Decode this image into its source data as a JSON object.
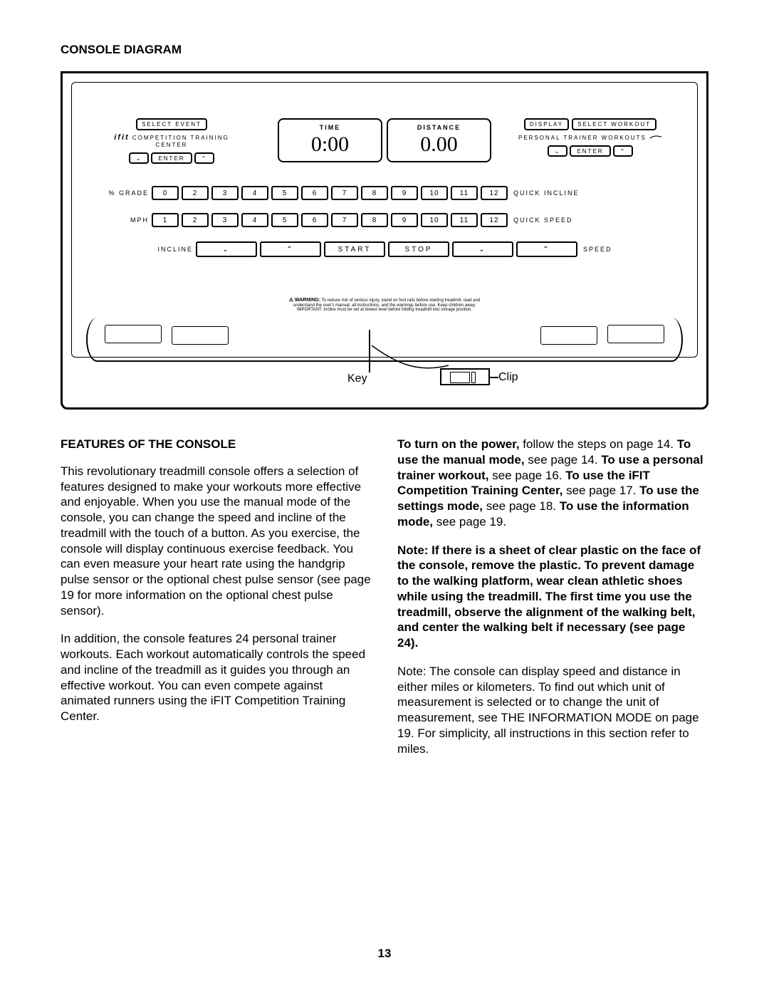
{
  "page_number": "13",
  "titles": {
    "diagram": "CONSOLE DIAGRAM",
    "features": "FEATURES OF THE CONSOLE"
  },
  "console": {
    "left_cluster": {
      "select_event": "SELECT EVENT",
      "ifit_prefix": "ifit",
      "ifit_text": " COMPETITION TRAINING CENTER",
      "enter": "ENTER"
    },
    "right_cluster": {
      "display": "DISPLAY",
      "select_workout": "SELECT WORKOUT",
      "ptw": "PERSONAL TRAINER WORKOUTS",
      "enter": "ENTER"
    },
    "displays": {
      "time_label": "TIME",
      "time_value": "0:00",
      "distance_label": "DISTANCE",
      "distance_value": "0.00"
    },
    "rows": {
      "grade_label": "% GRADE",
      "grade_vals": [
        "0",
        "2",
        "3",
        "4",
        "5",
        "6",
        "7",
        "8",
        "9",
        "10",
        "11",
        "12"
      ],
      "grade_suffix": "QUICK INCLINE",
      "mph_label": "MPH",
      "mph_vals": [
        "1",
        "2",
        "3",
        "4",
        "5",
        "6",
        "7",
        "8",
        "9",
        "10",
        "11",
        "12"
      ],
      "mph_suffix": "QUICK SPEED",
      "ctrl_incline": "INCLINE",
      "ctrl_start": "START",
      "ctrl_stop": "STOP",
      "ctrl_speed": "SPEED"
    },
    "warning": {
      "label": "⚠ WARNING:",
      "text": "To reduce risk of serious injury, stand on foot rails before starting treadmill, read and understand the user's manual, all instructions, and the warnings before use. Keep children away. IMPORTANT: Incline must be set at lowest level before folding treadmill into storage position."
    },
    "key_label": "Key",
    "clip_label": "Clip"
  },
  "body": {
    "p1": "This revolutionary treadmill console offers a selection of features designed to make your workouts more effective and enjoyable. When you use the manual mode of the console, you can change the speed and incline of the treadmill with the touch of a button. As you exercise, the console will display continuous exercise feedback. You can even measure your heart rate using the handgrip pulse sensor or the optional chest pulse sensor (see page 19 for more information on the optional chest pulse sensor).",
    "p2": "In addition, the console features 24 personal trainer workouts. Each workout automatically controls the speed and incline of the treadmill as it guides you through an effective workout. You can even compete against animated runners using the iFIT Competition Training Center.",
    "r1_a": "To turn on the power,",
    "r1_b": " follow the steps on page 14. ",
    "r1_c": "To use the manual mode,",
    "r1_d": " see page 14. ",
    "r1_e": "To use a personal trainer workout,",
    "r1_f": " see page 16. ",
    "r1_g": "To use the iFIT Competition Training Center,",
    "r1_h": " see page 17. ",
    "r1_i": "To use the settings mode,",
    "r1_j": " see page 18. ",
    "r1_k": "To use the information mode,",
    "r1_l": " see page 19.",
    "r2": "Note: If there is a sheet of clear plastic on the face of the console, remove the plastic. To prevent damage to the walking platform, wear clean athletic shoes while using the treadmill. The first time you use the treadmill, observe the alignment of the walking belt, and center the walking belt if necessary (see page 24).",
    "r3": "Note: The console can display speed and distance in either miles or kilometers. To find out which unit of measurement is selected or to change the unit of measurement, see THE INFORMATION MODE on page 19. For simplicity, all instructions in this section refer to miles."
  }
}
